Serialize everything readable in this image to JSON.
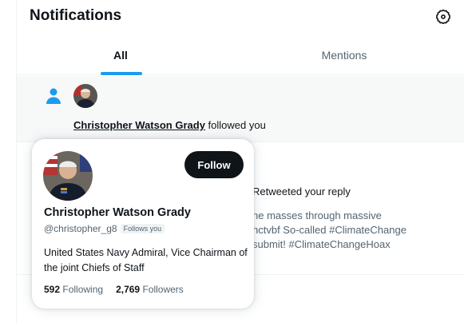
{
  "header": {
    "title": "Notifications",
    "settings_icon": "gear-icon"
  },
  "tabs": [
    {
      "label": "All",
      "active": true
    },
    {
      "label": "Mentions",
      "active": false
    }
  ],
  "colors": {
    "accent": "#1d9bf0",
    "text": "#0f1419",
    "muted": "#536471",
    "button": "#0f1419"
  },
  "notifications": [
    {
      "type": "follow",
      "icon": "person-icon",
      "user_name": "Christopher Watson Grady",
      "action_text": " followed you"
    },
    {
      "type": "retweet",
      "action_text": "Retweeted your reply",
      "tweet_lines": [
        "ne masses through massive",
        "hctvbf So-called #ClimateChange",
        "submit! #ClimateChangeHoax"
      ]
    }
  ],
  "hovercard": {
    "name": "Christopher Watson Grady",
    "handle": "@christopher_g8",
    "follows_you_badge": "Follows you",
    "follow_button": "Follow",
    "bio": "United States Navy Admiral, Vice Chairman of the joint Chiefs of Staff",
    "following_count": "592",
    "following_label": "Following",
    "followers_count": "2,769",
    "followers_label": "Followers"
  }
}
